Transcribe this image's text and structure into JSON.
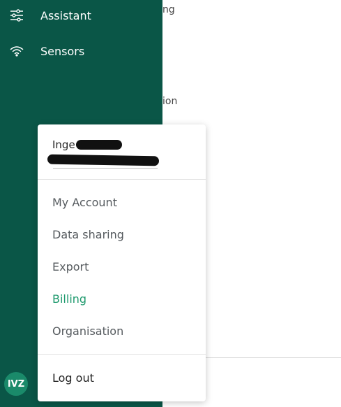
{
  "sidebar": {
    "items": [
      {
        "label": "Assistant",
        "icon": "sliders-icon"
      },
      {
        "label": "Sensors",
        "icon": "wifi-icon"
      }
    ],
    "avatar_initials": "IVZ",
    "bg_color": "#0a5647"
  },
  "background": {
    "text_1": "ng",
    "text_2": "ion"
  },
  "user_menu": {
    "user_name": "Inge",
    "items": [
      {
        "label": "My Account"
      },
      {
        "label": "Data sharing"
      },
      {
        "label": "Export"
      },
      {
        "label": "Billing",
        "active": true
      },
      {
        "label": "Organisation"
      }
    ],
    "logout_label": "Log out",
    "accent_color": "#1f9a6e"
  }
}
